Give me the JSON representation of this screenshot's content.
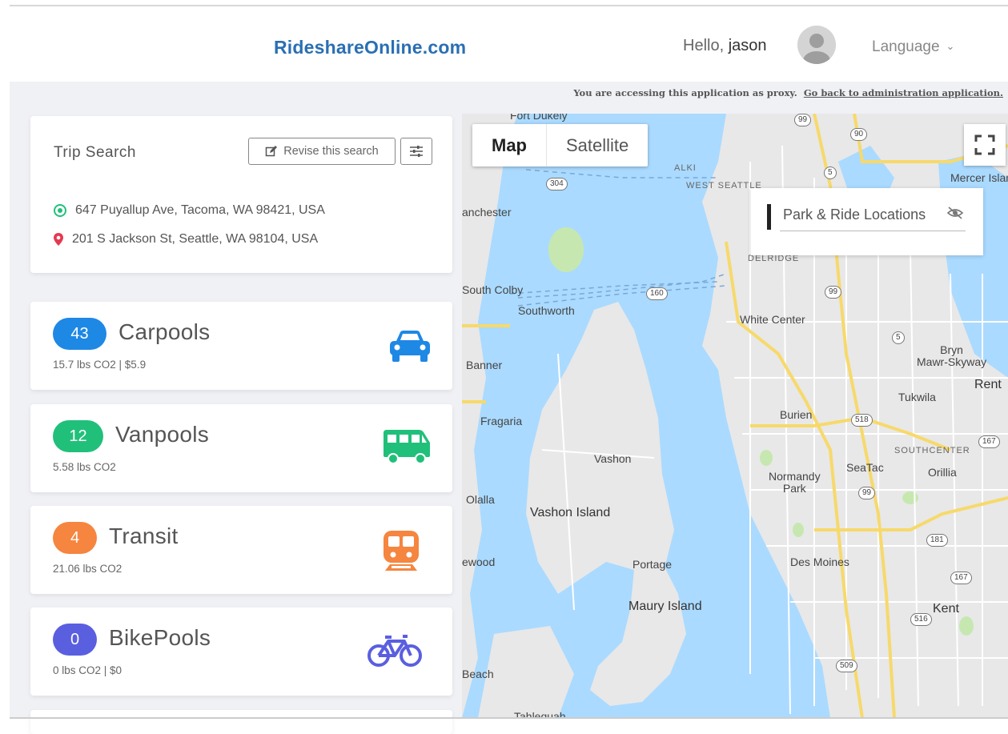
{
  "header": {
    "brand": "RideshareOnline.com",
    "greeting": "Hello,",
    "username": "jason",
    "language_label": "Language",
    "language_chevron": "chevron-down-icon"
  },
  "proxy_notice": {
    "text": "You are accessing this application as proxy.",
    "link": "Go back to administration application."
  },
  "trip_search": {
    "title": "Trip Search",
    "revise_label": "Revise this search",
    "origin": "647 Puyallup Ave, Tacoma, WA 98421, USA",
    "destination": "201 S Jackson St, Seattle, WA 98104, USA"
  },
  "modes": [
    {
      "count": "43",
      "label": "Carpools",
      "sub": "15.7 lbs CO2  |  $5.9",
      "color": "#1e88e5",
      "icon": "car-icon"
    },
    {
      "count": "12",
      "label": "Vanpools",
      "sub": "5.58 lbs CO2",
      "color": "#21c07a",
      "icon": "van-icon"
    },
    {
      "count": "4",
      "label": "Transit",
      "sub": "21.06 lbs CO2",
      "color": "#f5853f",
      "icon": "train-icon"
    },
    {
      "count": "0",
      "label": "BikePools",
      "sub": "0 lbs CO2  |  $0",
      "color": "#5a5fe0",
      "icon": "bicycle-icon"
    }
  ],
  "map": {
    "type_map": "Map",
    "type_satellite": "Satellite",
    "park_ride_label": "Park & Ride Locations",
    "labels": {
      "fort_dukely": "Fort Dukely",
      "manchester": "anchester",
      "south_colby": "South Colby",
      "southworth": "Southworth",
      "banner": "Banner",
      "fragaria": "Fragaria",
      "vashon": "Vashon",
      "vashon_island": "Vashon Island",
      "olalla": "Olalla",
      "ewood": "ewood",
      "portage": "Portage",
      "maury_island": "Maury Island",
      "beach": "Beach",
      "tahlequah": "Tahlequah",
      "west_seattle": "WEST SEATTLE",
      "alki": "ALKI",
      "delridge": "DELRIDGE",
      "white_center": "White Center",
      "burien": "Burien",
      "normandy_park": "Normandy\nPark",
      "seatac": "SeaTac",
      "des_moines": "Des Moines",
      "bryn_mawr": "Bryn\nMawr-Skyway",
      "tukwila": "Tukwila",
      "southcenter": "SOUTHCENTER",
      "orillia": "Orillia",
      "kent": "Kent",
      "renton": "Rent",
      "mercer_island": "Mercer Islan"
    },
    "shields": [
      "99",
      "90",
      "5",
      "304",
      "160",
      "99",
      "5",
      "518",
      "99",
      "167",
      "181",
      "167",
      "516",
      "509"
    ]
  },
  "colors": {
    "brand": "#2a6fb3",
    "water": "#aadaff",
    "land": "#e8e8e8",
    "road_major": "#f7d96b",
    "park": "#c6e8b0"
  }
}
